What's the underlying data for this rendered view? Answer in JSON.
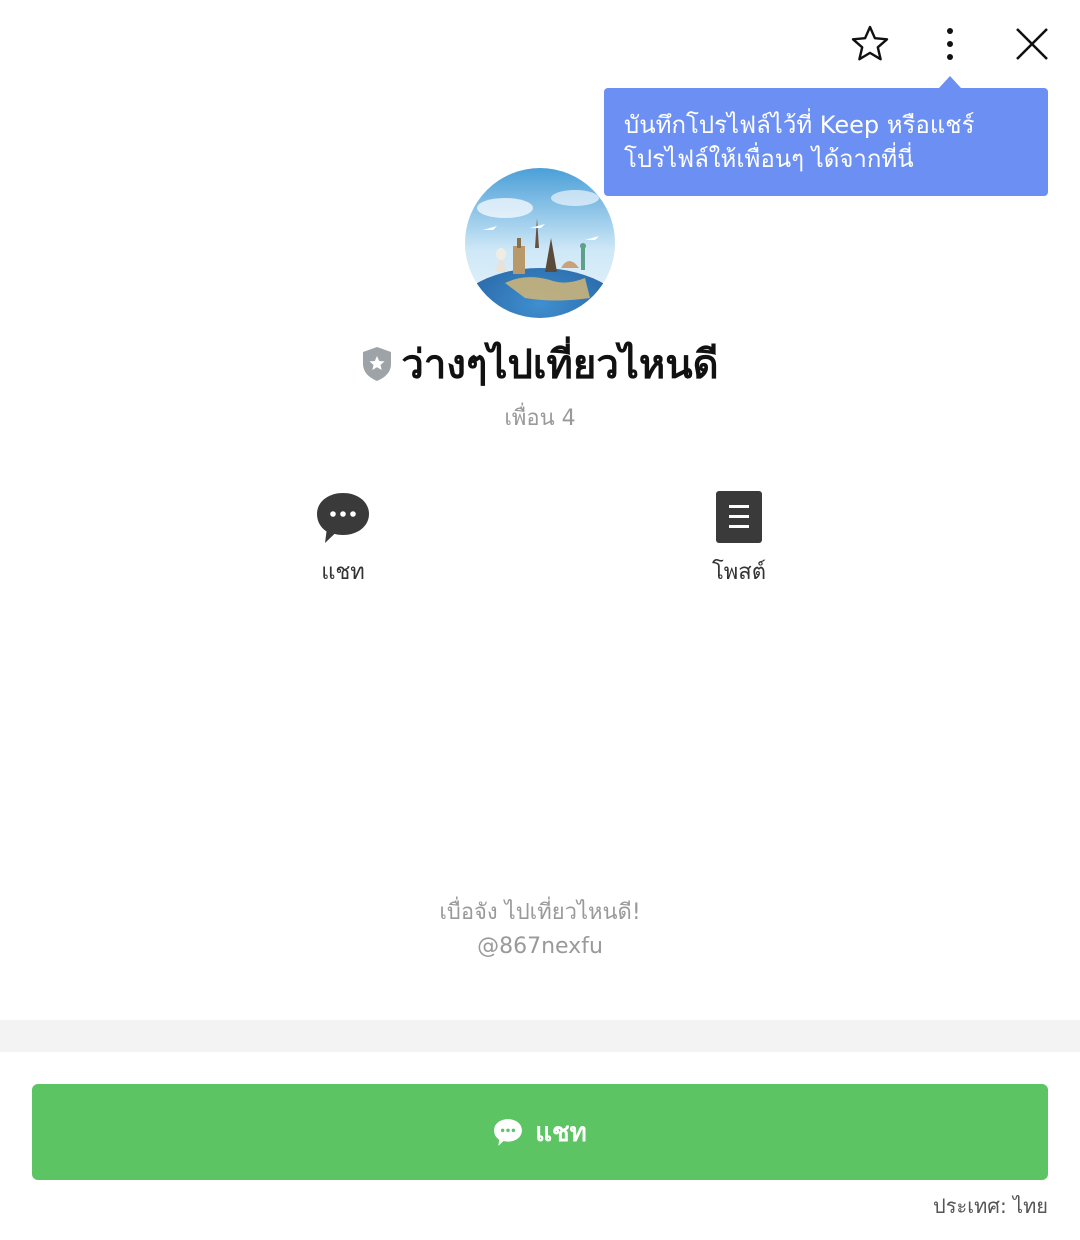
{
  "header": {
    "icons": [
      "star-icon",
      "more-vertical-icon",
      "close-icon"
    ]
  },
  "tooltip": {
    "line1": "บันทึกโปรไฟล์ไว้ที่ Keep หรือแชร์",
    "line2": "โปรไฟล์ให้เพื่อนๆ ได้จากที่นี่",
    "color": "#6c8ff3"
  },
  "profile": {
    "name": "ว่างๆไปเที่ยวไหนดี",
    "friends": "เพื่อน 4",
    "status_message": "เบื่อจัง ไปเที่ยวไหนดี!",
    "id": "@867nexfu"
  },
  "actions": [
    {
      "label": "แชท",
      "icon": "chat-bubble-icon"
    },
    {
      "label": "โพสต์",
      "icon": "post-document-icon"
    }
  ],
  "chat_button": {
    "label": "แชท",
    "icon": "chat-bubble-icon",
    "color": "#5cc463"
  },
  "footer": {
    "country": "ประเทศ: ไทย"
  }
}
